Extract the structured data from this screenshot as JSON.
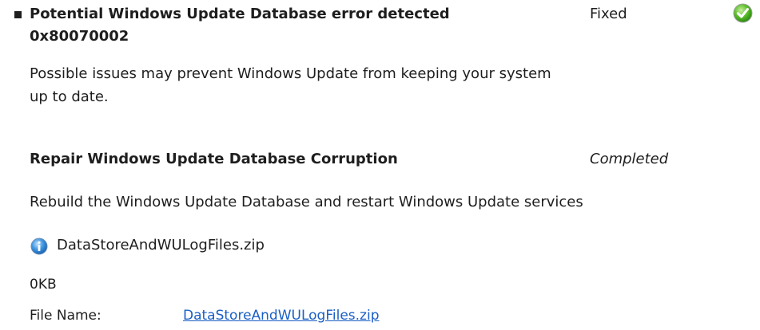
{
  "issue": {
    "title": "Potential Windows Update Database error detected 0x80070002",
    "status": "Fixed",
    "status_icon": "green-check-icon",
    "description": "Possible issues may prevent Windows Update from keeping your system up to date."
  },
  "resolution": {
    "title": "Repair Windows Update Database Corruption",
    "status": "Completed",
    "description": "Rebuild the Windows Update Database and restart Windows Update services"
  },
  "attachment": {
    "icon": "info-icon",
    "name": "DataStoreAndWULogFiles.zip",
    "size": "0KB",
    "file_name_label": "File Name:",
    "file_name_link": "DataStoreAndWULogFiles.zip"
  },
  "colors": {
    "link": "#1a5fc6",
    "check_green": "#3a9a1a",
    "info_blue": "#2a7fd4"
  }
}
